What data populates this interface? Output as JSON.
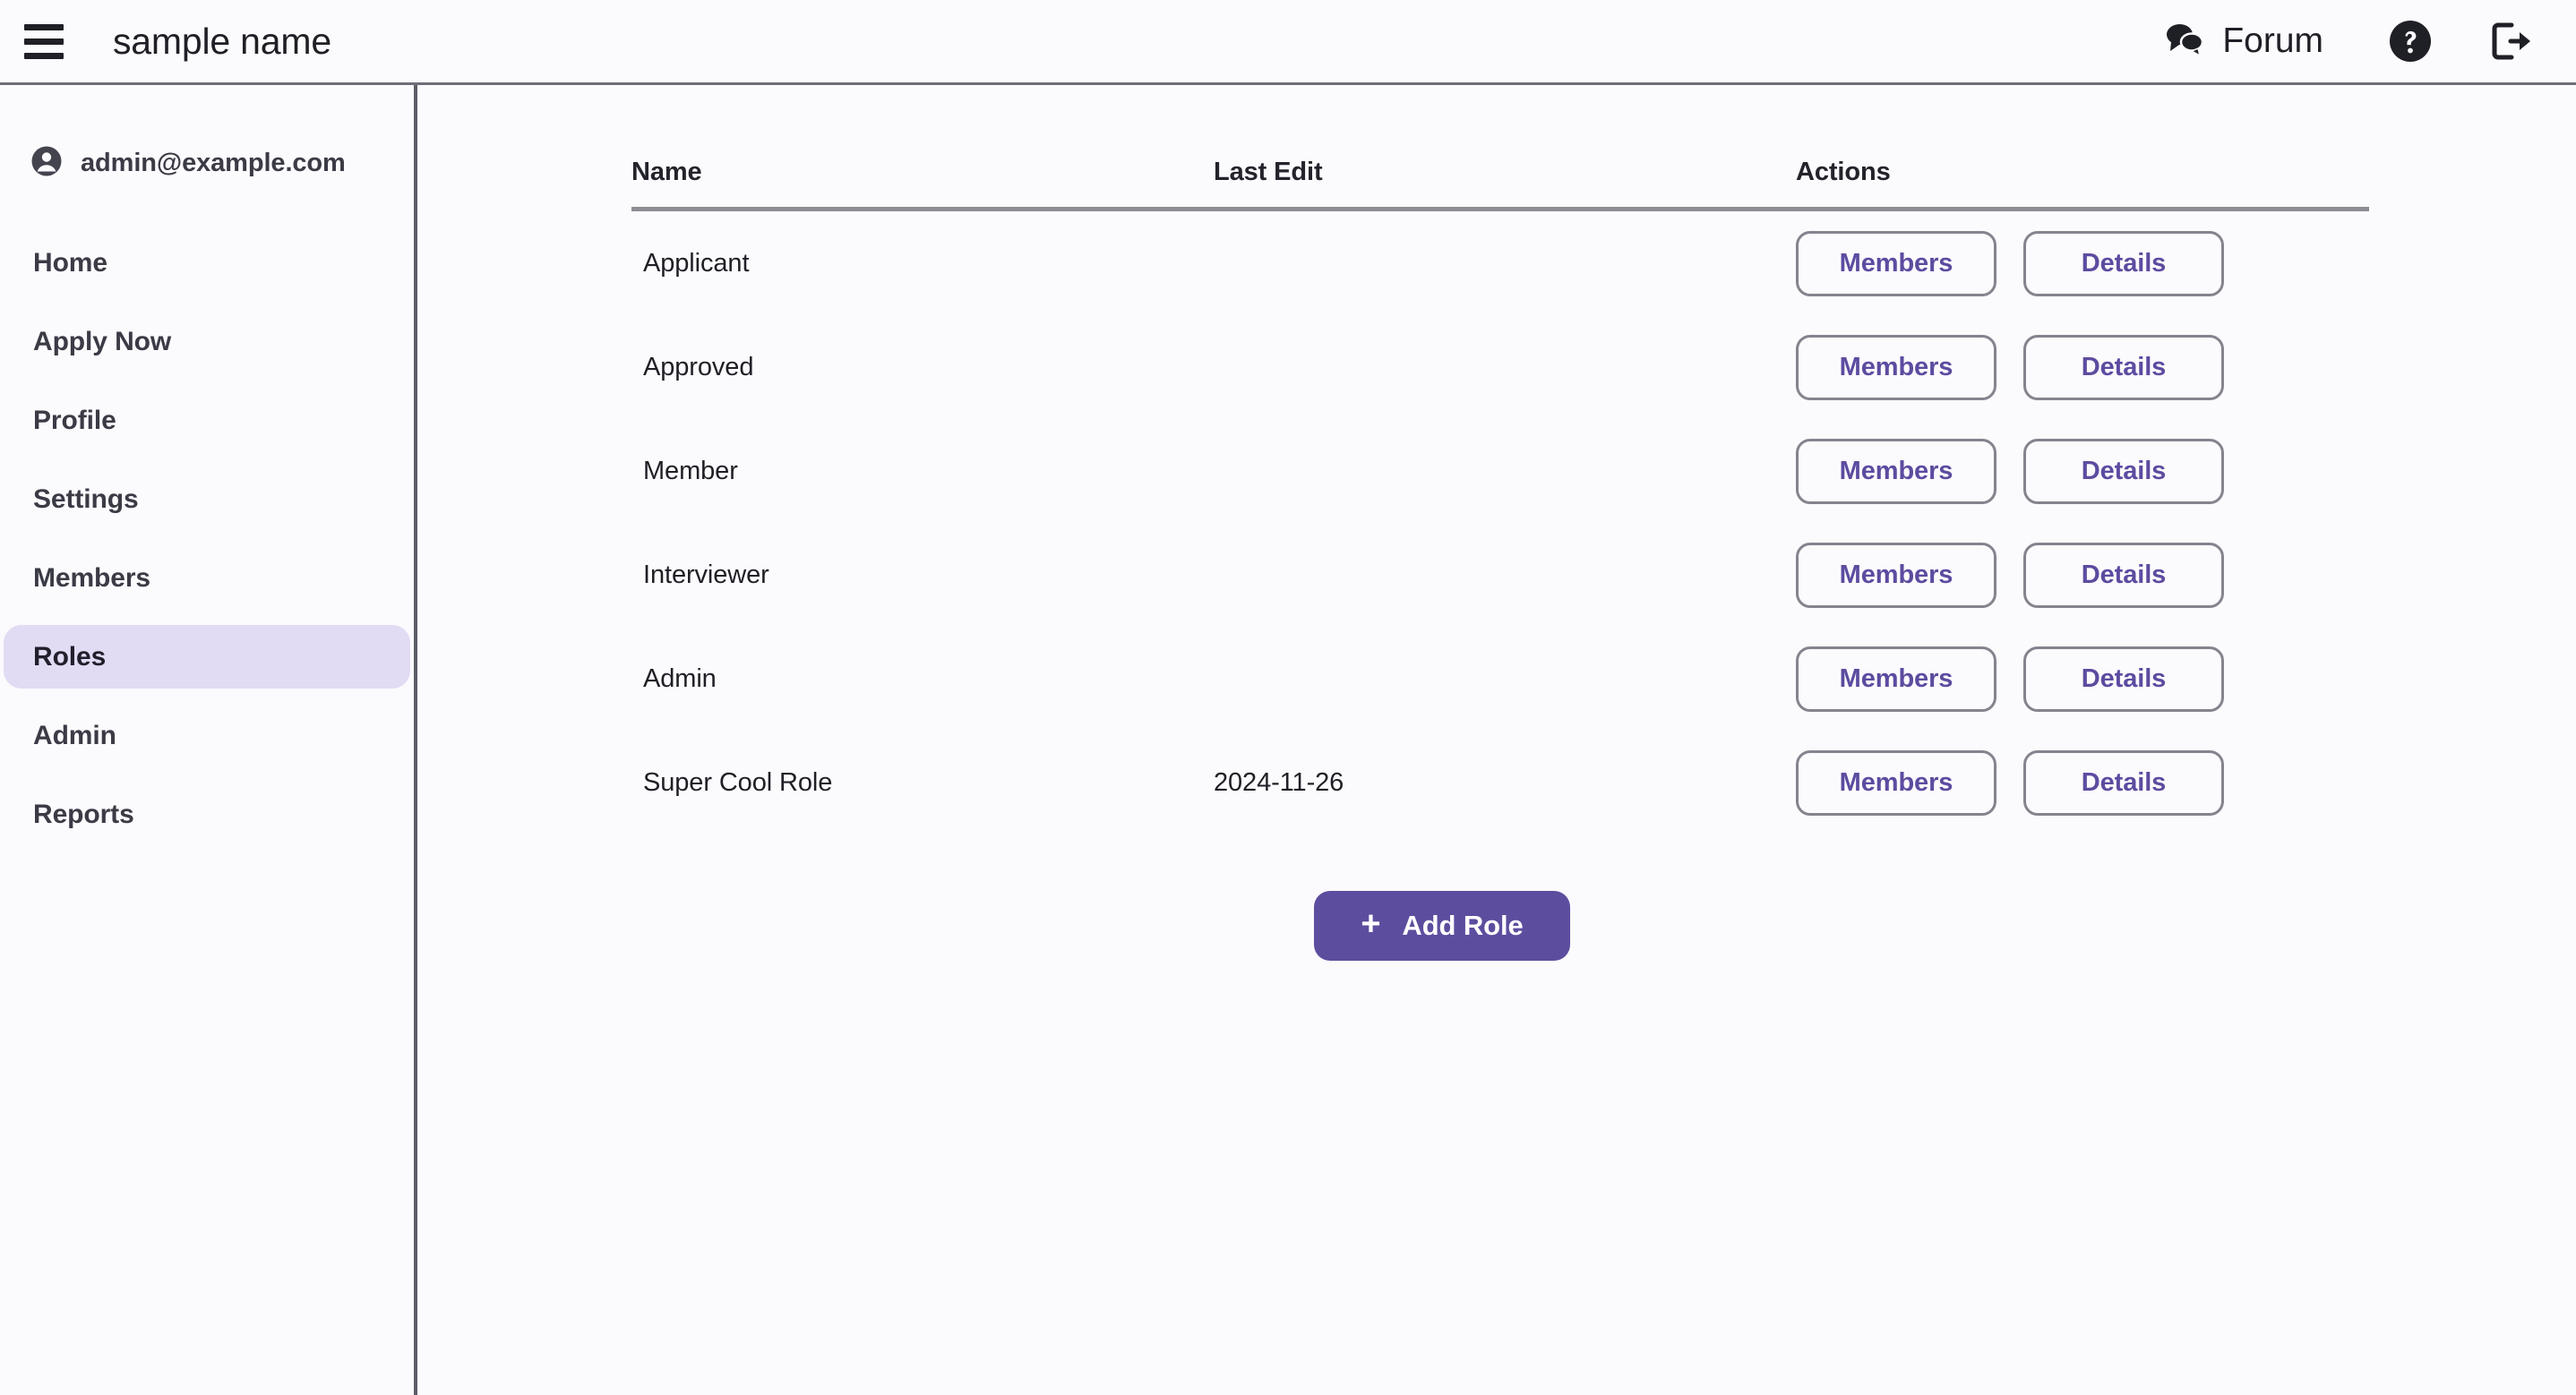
{
  "header": {
    "menu_icon": "hamburger-icon",
    "title": "sample name",
    "forum_label": "Forum",
    "forum_icon": "comments-icon",
    "help_icon": "help-circle-icon",
    "logout_icon": "logout-icon"
  },
  "sidebar": {
    "user": {
      "avatar_icon": "account-circle-icon",
      "email": "admin@example.com"
    },
    "items": [
      {
        "label": "Home",
        "active": false
      },
      {
        "label": "Apply Now",
        "active": false
      },
      {
        "label": "Profile",
        "active": false
      },
      {
        "label": "Settings",
        "active": false
      },
      {
        "label": "Members",
        "active": false
      },
      {
        "label": "Roles",
        "active": true
      },
      {
        "label": "Admin",
        "active": false
      },
      {
        "label": "Reports",
        "active": false
      }
    ]
  },
  "main": {
    "table": {
      "columns": [
        "Name",
        "Last Edit",
        "Actions"
      ],
      "rows": [
        {
          "name": "Applicant",
          "last_edit": "",
          "members_label": "Members",
          "details_label": "Details"
        },
        {
          "name": "Approved",
          "last_edit": "",
          "members_label": "Members",
          "details_label": "Details"
        },
        {
          "name": "Member",
          "last_edit": "",
          "members_label": "Members",
          "details_label": "Details"
        },
        {
          "name": "Interviewer",
          "last_edit": "",
          "members_label": "Members",
          "details_label": "Details"
        },
        {
          "name": "Admin",
          "last_edit": "",
          "members_label": "Members",
          "details_label": "Details"
        },
        {
          "name": "Super Cool Role",
          "last_edit": "2024-11-26",
          "members_label": "Members",
          "details_label": "Details"
        }
      ]
    },
    "add_role": {
      "label": "Add Role",
      "icon": "plus-icon",
      "glyph": "+"
    }
  },
  "colors": {
    "accent_purple": "#5d4d9e",
    "accent_purple_text": "#5d4ba0",
    "active_nav_bg": "#e2dbf4",
    "page_bg": "#fbfafd",
    "border_gray": "#5c5c68",
    "divider_gray": "#8d8d93"
  }
}
